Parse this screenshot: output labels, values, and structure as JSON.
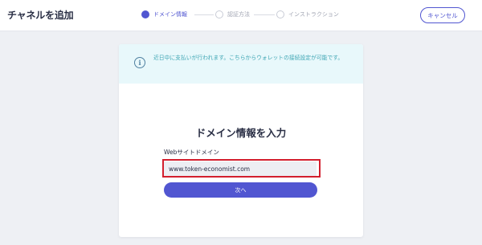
{
  "header": {
    "title": "チャネルを追加",
    "cancel_label": "キャンセル"
  },
  "steps": [
    {
      "label": "ドメイン情報",
      "state": "active"
    },
    {
      "label": "認証方法",
      "state": "inactive"
    },
    {
      "label": "インストラクション",
      "state": "inactive"
    }
  ],
  "notice": {
    "icon": "info-icon",
    "text": "近日中に支払いが行われます。こちらからウォレットの接続設定が可能です。"
  },
  "form": {
    "heading": "ドメイン情報を入力",
    "website_label": "Webサイトドメイン",
    "website_value": "www.token-economist.com",
    "next_label": "次へ"
  },
  "colors": {
    "accent": "#5156d1",
    "notice_bg": "#e8f8fb",
    "notice_text": "#3fa6b4",
    "highlight": "#d31f2e"
  }
}
